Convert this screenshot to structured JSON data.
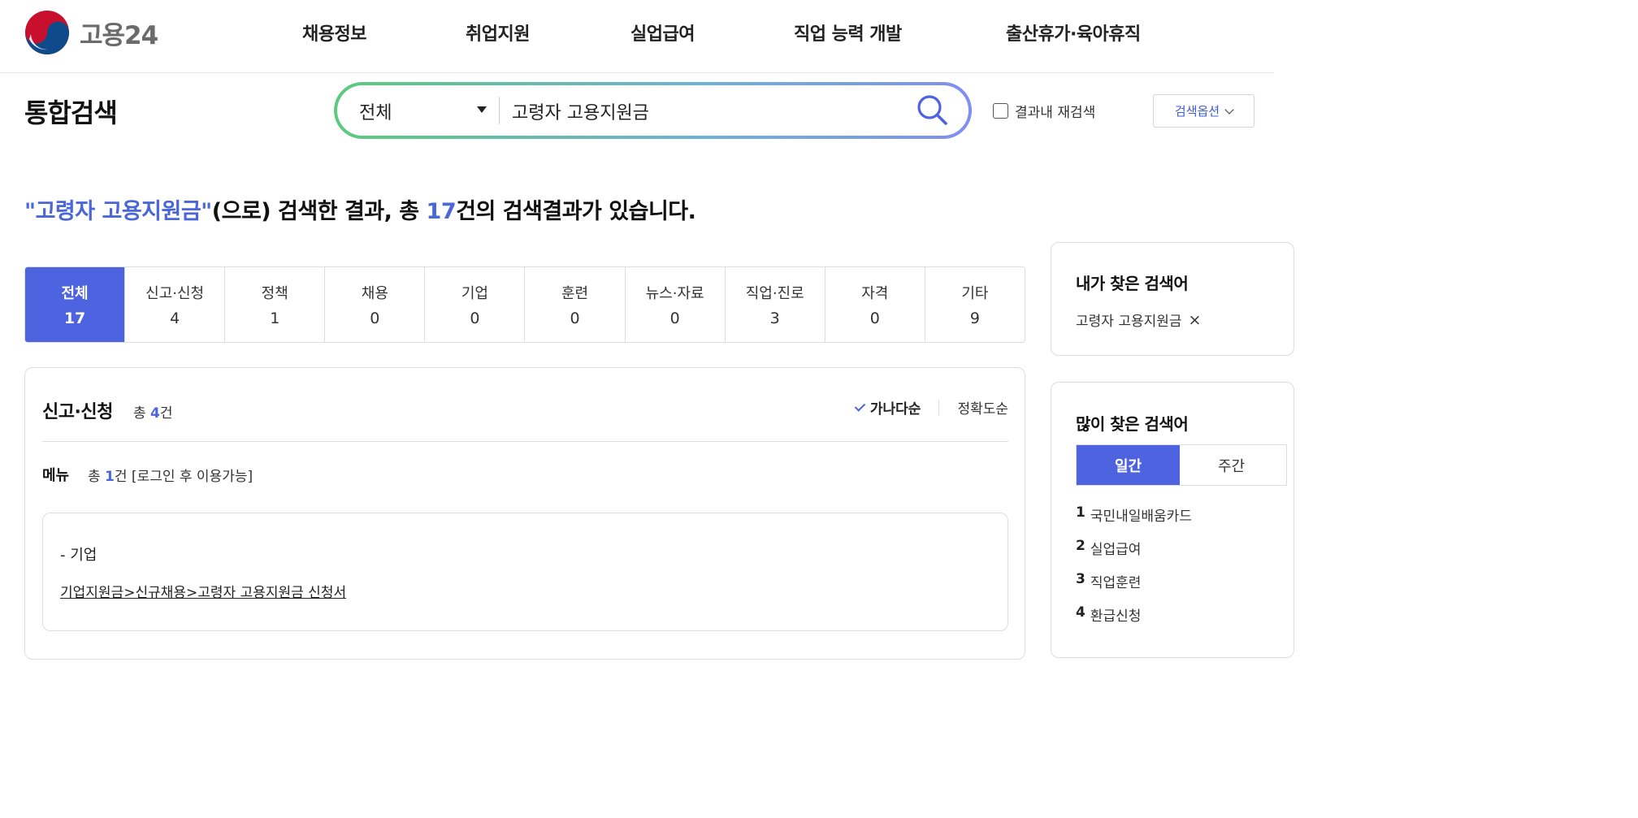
{
  "header": {
    "logo_text": "고용24",
    "nav": [
      "채용정보",
      "취업지원",
      "실업급여",
      "직업 능력 개발",
      "출산휴가·육아휴직"
    ]
  },
  "search": {
    "page_title": "통합검색",
    "scope": "전체",
    "query": "고령자 고용지원금",
    "recheck_label": "결과내 재검색",
    "options_label": "검색옵션"
  },
  "summary": {
    "query_quoted": "\"고령자 고용지원금\"",
    "middle": "(으로) 검색한 결과, 총 ",
    "total": "17",
    "suffix": "건의 검색결과가 있습니다."
  },
  "tabs": [
    {
      "label": "전체",
      "count": "17",
      "active": true
    },
    {
      "label": "신고·신청",
      "count": "4"
    },
    {
      "label": "정책",
      "count": "1"
    },
    {
      "label": "채용",
      "count": "0"
    },
    {
      "label": "기업",
      "count": "0"
    },
    {
      "label": "훈련",
      "count": "0"
    },
    {
      "label": "뉴스·자료",
      "count": "0"
    },
    {
      "label": "직업·진로",
      "count": "3"
    },
    {
      "label": "자격",
      "count": "0"
    },
    {
      "label": "기타",
      "count": "9"
    }
  ],
  "section": {
    "title": "신고·신청",
    "count_prefix": "총 ",
    "count": "4",
    "count_suffix": "건",
    "sort_selected": "가나다순",
    "sort_other": "정확도순",
    "sub_title": "메뉴",
    "sub_count_prefix": "총 ",
    "sub_count": "1",
    "sub_count_suffix": "건 [로그인 후 이용가능]",
    "card": {
      "category": "- 기업",
      "link": "기업지원금>신규채용>고령자 고용지원금 신청서"
    }
  },
  "sidebar": {
    "my_keywords_title": "내가 찾은 검색어",
    "my_keyword": "고령자 고용지원금",
    "remove_glyph": "×",
    "popular_title": "많이 찾은 검색어",
    "periods": [
      "일간",
      "주간"
    ],
    "ranking": [
      {
        "rank": "1",
        "term": "국민내일배움카드"
      },
      {
        "rank": "2",
        "term": "실업급여"
      },
      {
        "rank": "3",
        "term": "직업훈련"
      },
      {
        "rank": "4",
        "term": "환급신청"
      }
    ]
  },
  "colors": {
    "accent": "#4e63e0",
    "highlight_text": "#4a66d8",
    "search_gradient_start": "#5ccb7c",
    "search_gradient_end": "#7f8ff0"
  }
}
